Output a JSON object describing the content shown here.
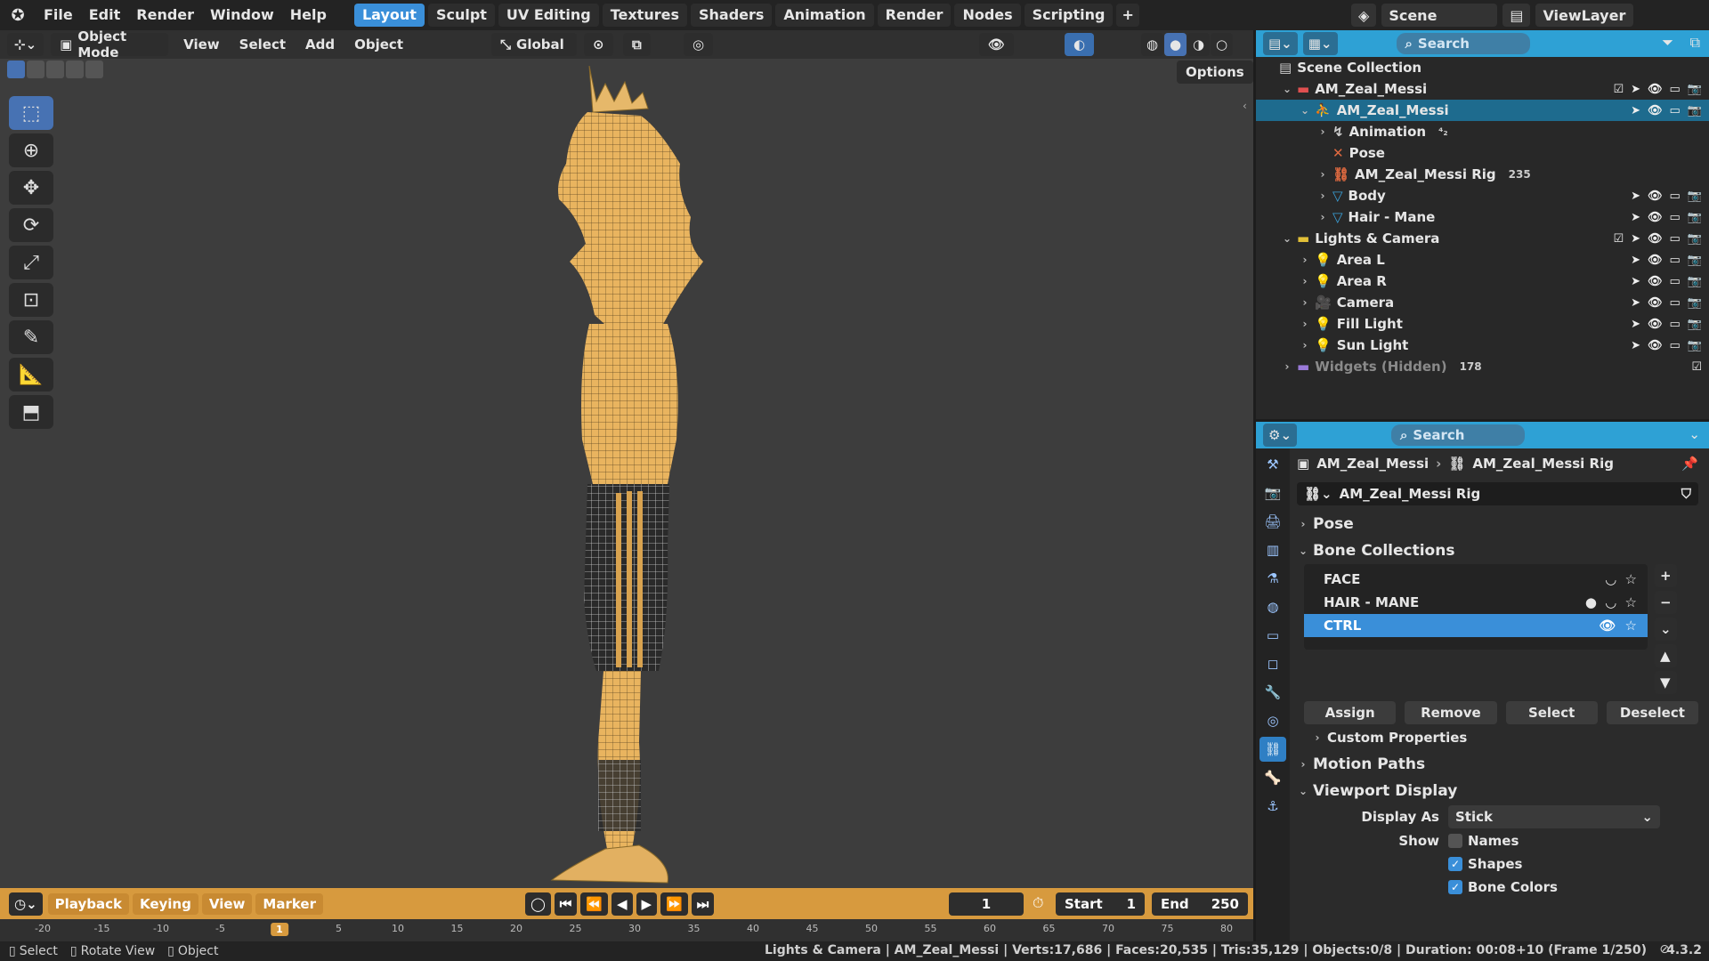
{
  "menu": [
    "File",
    "Edit",
    "Render",
    "Window",
    "Help"
  ],
  "workspaces": [
    {
      "label": "Layout",
      "active": true
    },
    {
      "label": "Sculpt"
    },
    {
      "label": "UV Editing"
    },
    {
      "label": "Textures"
    },
    {
      "label": "Shaders"
    },
    {
      "label": "Animation"
    },
    {
      "label": "Render"
    },
    {
      "label": "Nodes"
    },
    {
      "label": "Scripting"
    }
  ],
  "add_workspace": "+",
  "scene": {
    "label": "Scene",
    "viewlayer": "ViewLayer"
  },
  "viewport": {
    "mode": "Object Mode",
    "menus": [
      "View",
      "Select",
      "Add",
      "Object"
    ],
    "orientation": "Global",
    "options": "Options"
  },
  "timeline": {
    "menus": [
      "Playback",
      "Keying",
      "View",
      "Marker"
    ],
    "current_frame": "1",
    "start_label": "Start",
    "start": "1",
    "end_label": "End",
    "end": "250",
    "ruler": [
      "-20",
      "-15",
      "-10",
      "-5",
      "1",
      "5",
      "10",
      "15",
      "20",
      "25",
      "30",
      "35",
      "40",
      "45",
      "50",
      "55",
      "60",
      "65",
      "70",
      "75",
      "80"
    ]
  },
  "status": {
    "left": [
      "Select",
      "Rotate View",
      "Object"
    ],
    "right": "Lights & Camera | AM_Zeal_Messi | Verts:17,686 | Faces:20,535 | Tris:35,129 | Objects:0/8 | Duration: 00:08+10 (Frame 1/250)",
    "version": "4.3.2"
  },
  "outliner": {
    "search": "Search",
    "rows": [
      {
        "label": "Scene Collection",
        "indent": 0,
        "icon": "scene-collection-icon",
        "color": "#cccccc"
      },
      {
        "label": "AM_Zeal_Messi",
        "indent": 1,
        "icon": "collection-icon",
        "color": "#e05050",
        "chev": "v",
        "vis": true,
        "check": true
      },
      {
        "label": "AM_Zeal_Messi",
        "indent": 2,
        "icon": "armature-icon",
        "color": "#3aa0d8",
        "chev": "v",
        "selected": true,
        "vis": true
      },
      {
        "label": "Animation",
        "indent": 3,
        "icon": "animation-icon",
        "color": "#cccccc",
        "chev": ">",
        "extra": "⁴₂"
      },
      {
        "label": "Pose",
        "indent": 3,
        "icon": "pose-icon",
        "color": "#e06a40"
      },
      {
        "label": "AM_Zeal_Messi Rig",
        "indent": 3,
        "icon": "armature-data-icon",
        "color": "#e06a40",
        "chev": ">",
        "extra": "235"
      },
      {
        "label": "Body",
        "indent": 3,
        "icon": "mesh-icon",
        "color": "#3aa0d8",
        "chev": ">",
        "vis": true
      },
      {
        "label": "Hair - Mane",
        "indent": 3,
        "icon": "mesh-icon",
        "color": "#3aa0d8",
        "chev": ">",
        "vis": true
      },
      {
        "label": "Lights & Camera",
        "indent": 1,
        "icon": "collection-icon",
        "color": "#e2c038",
        "chev": "v",
        "vis": true,
        "check": true
      },
      {
        "label": "Area L",
        "indent": 2,
        "icon": "light-icon",
        "color": "#3aa0d8",
        "chev": ">",
        "vis": true
      },
      {
        "label": "Area R",
        "indent": 2,
        "icon": "light-icon",
        "color": "#3aa0d8",
        "chev": ">",
        "vis": true
      },
      {
        "label": "Camera",
        "indent": 2,
        "icon": "camera-icon",
        "color": "#3aa0d8",
        "chev": ">",
        "vis": true
      },
      {
        "label": "Fill Light",
        "indent": 2,
        "icon": "light-icon",
        "color": "#3aa0d8",
        "chev": ">",
        "vis": true
      },
      {
        "label": "Sun Light",
        "indent": 2,
        "icon": "light-icon",
        "color": "#3aa0d8",
        "chev": ">",
        "vis": true
      },
      {
        "label": "Widgets (Hidden)",
        "indent": 1,
        "icon": "collection-icon",
        "color": "#9a7ad8",
        "chev": ">",
        "check": true,
        "dim": true,
        "extra": "178"
      }
    ]
  },
  "properties": {
    "search": "Search",
    "breadcrumb": [
      "AM_Zeal_Messi",
      "AM_Zeal_Messi Rig"
    ],
    "data_name": "AM_Zeal_Messi Rig",
    "sections": {
      "pose": "Pose",
      "bone_collections": "Bone Collections",
      "custom_properties": "Custom Properties",
      "motion_paths": "Motion Paths",
      "viewport_display": "Viewport Display"
    },
    "bone_collections": [
      {
        "label": "FACE"
      },
      {
        "label": "HAIR - MANE",
        "dot": true
      },
      {
        "label": "CTRL",
        "active": true
      }
    ],
    "buttons": [
      "Assign",
      "Remove",
      "Select",
      "Deselect"
    ],
    "display_as_label": "Display As",
    "display_as": "Stick",
    "show_label": "Show",
    "show": [
      {
        "label": "Names",
        "checked": false
      },
      {
        "label": "Shapes",
        "checked": true
      },
      {
        "label": "Bone Colors",
        "checked": true
      }
    ]
  },
  "colors": {
    "accent": "#2ea1d5",
    "timeline": "#d79a3e",
    "active_tab": "#3a8fd9"
  }
}
